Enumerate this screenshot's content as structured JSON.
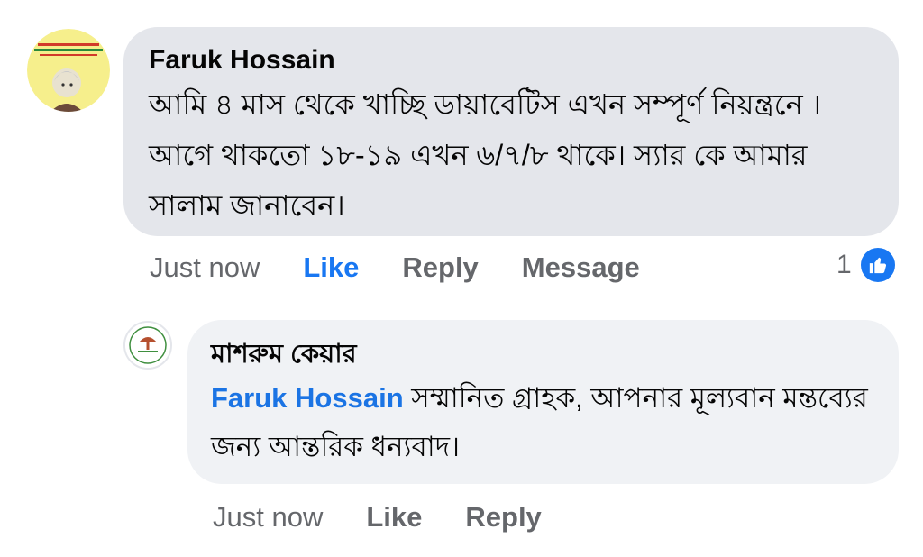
{
  "comment": {
    "author": "Faruk Hossain",
    "text": "আমি ৪ মাস থেকে খাচ্ছি ডায়াবেটিস এখন সম্পূর্ণ নিয়ন্ত্রনে । আগে থাকতো ১৮-১৯ এখন ৬/৭/৮ থাকে। স্যার কে আমার সালাম জানাবেন।",
    "timestamp": "Just now",
    "like_label": "Like",
    "reply_label": "Reply",
    "message_label": "Message",
    "reaction_count": "1",
    "reaction_icon": "like-icon",
    "accent_color": "#1877f2"
  },
  "reply": {
    "author": "মাশরুম কেয়ার",
    "mention": "Faruk Hossain",
    "text": "সম্মানিত গ্রাহক, আপনার মূল্যবান মন্তব্যের জন্য আন্তরিক ধন্যবাদ।",
    "timestamp": "Just now",
    "like_label": "Like",
    "reply_label": "Reply"
  }
}
